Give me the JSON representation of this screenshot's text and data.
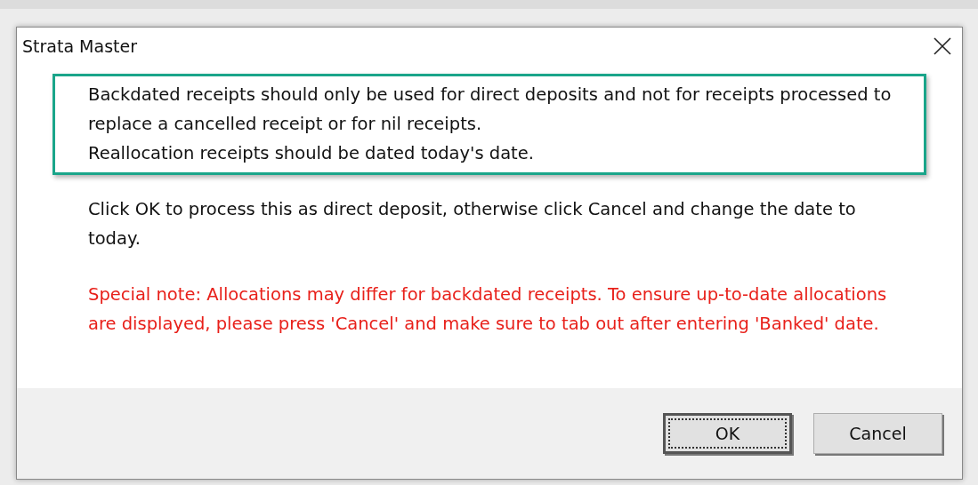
{
  "window": {
    "title": "Strata Master"
  },
  "highlighted_message": [
    "Backdated receipts should only be used for direct deposits and not for receipts processed to replace a cancelled receipt or for nil receipts.",
    "Reallocation receipts should be dated today's date."
  ],
  "instruction": "Click OK to process this as direct deposit, otherwise click Cancel and change the date to today.",
  "special_note": "Special note: Allocations may differ for backdated receipts. To ensure up-to-date allocations are displayed, please press 'Cancel' and make sure to tab out after entering 'Banked' date.",
  "buttons": [
    {
      "label": "OK",
      "default": true
    },
    {
      "label": "Cancel",
      "default": false
    }
  ]
}
